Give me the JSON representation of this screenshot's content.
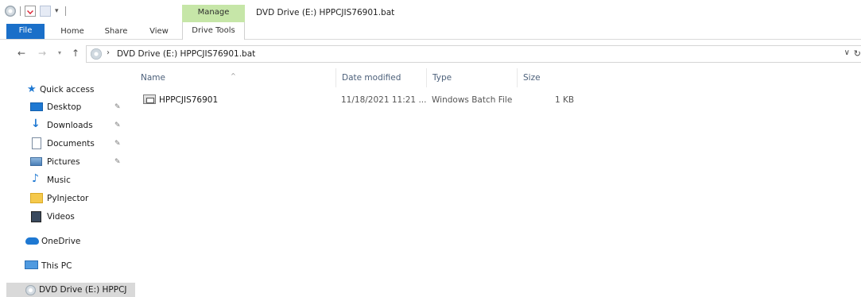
{
  "titlebar": {
    "manage_tab": "Manage",
    "window_title": "DVD Drive (E:) HPPCJIS76901.bat"
  },
  "ribbon": {
    "tabs": [
      "File",
      "Home",
      "Share",
      "View",
      "Drive Tools"
    ]
  },
  "address": {
    "path": "DVD Drive (E:) HPPCJIS76901.bat"
  },
  "columns": {
    "name": "Name",
    "date_modified": "Date modified",
    "type": "Type",
    "size": "Size"
  },
  "files": [
    {
      "name": "HPPCJIS76901",
      "date_modified": "11/18/2021 11:21 ...",
      "type": "Windows Batch File",
      "size": "1 KB"
    }
  ],
  "nav": {
    "quick_access": "Quick access",
    "items": [
      {
        "label": "Desktop",
        "pinned": true,
        "icon": "desktop-icon"
      },
      {
        "label": "Downloads",
        "pinned": true,
        "icon": "downloads-icon"
      },
      {
        "label": "Documents",
        "pinned": true,
        "icon": "documents-icon"
      },
      {
        "label": "Pictures",
        "pinned": true,
        "icon": "pictures-icon"
      },
      {
        "label": "Music",
        "pinned": false,
        "icon": "music-icon"
      },
      {
        "label": "PyInjector",
        "pinned": false,
        "icon": "folder-icon"
      },
      {
        "label": "Videos",
        "pinned": false,
        "icon": "videos-icon"
      }
    ],
    "onedrive": "OneDrive",
    "this_pc": "This PC",
    "dvd_drive": "DVD Drive (E:) HPPCJ"
  },
  "colors": {
    "file_tab": "#1a6fc9",
    "manage_tab": "#c6e6a8",
    "header_text": "#4c607a",
    "selected_nav": "#d9d9d9"
  }
}
